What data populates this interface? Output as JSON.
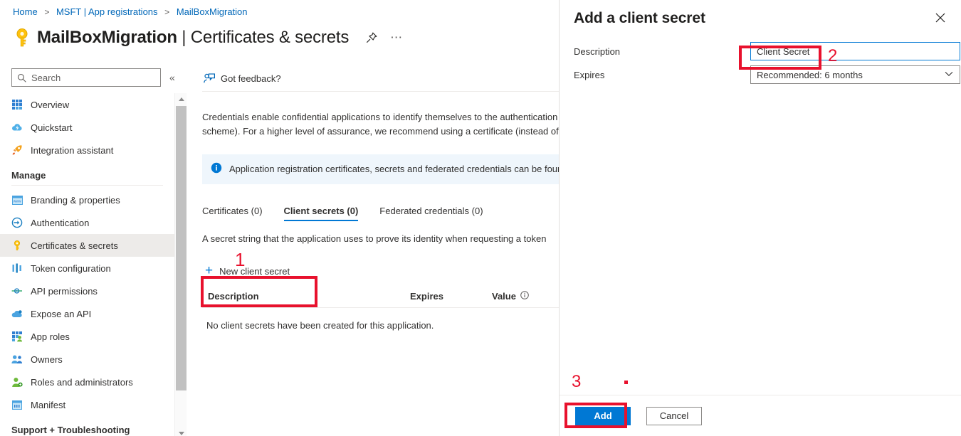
{
  "breadcrumb": {
    "items": [
      "Home",
      "MSFT | App registrations",
      "MailBoxMigration"
    ],
    "separator": ">"
  },
  "header": {
    "icon": "key-icon",
    "app_name": "MailBoxMigration",
    "divider": "|",
    "section": "Certificates & secrets",
    "pin_icon": "pin-icon",
    "more_icon": "ellipsis-icon"
  },
  "sidebar": {
    "search_placeholder": "Search",
    "search_value": "",
    "search_icon": "search-icon",
    "collapse_icon": "chevron-double-left-icon",
    "items": [
      {
        "label": "Overview",
        "icon": "grid-icon",
        "selected": false
      },
      {
        "label": "Quickstart",
        "icon": "cloud-lightning-icon",
        "selected": false
      },
      {
        "label": "Integration assistant",
        "icon": "rocket-icon",
        "selected": false
      }
    ],
    "group_label": "Manage",
    "manage_items": [
      {
        "label": "Branding & properties",
        "icon": "branding-icon",
        "selected": false
      },
      {
        "label": "Authentication",
        "icon": "authentication-icon",
        "selected": false
      },
      {
        "label": "Certificates & secrets",
        "icon": "key-icon",
        "selected": true
      },
      {
        "label": "Token configuration",
        "icon": "token-icon",
        "selected": false
      },
      {
        "label": "API permissions",
        "icon": "api-permissions-icon",
        "selected": false
      },
      {
        "label": "Expose an API",
        "icon": "expose-api-icon",
        "selected": false
      },
      {
        "label": "App roles",
        "icon": "app-roles-icon",
        "selected": false
      },
      {
        "label": "Owners",
        "icon": "owners-icon",
        "selected": false
      },
      {
        "label": "Roles and administrators",
        "icon": "roles-admin-icon",
        "selected": false
      },
      {
        "label": "Manifest",
        "icon": "manifest-icon",
        "selected": false
      }
    ],
    "bottom_group_label": "Support + Troubleshooting"
  },
  "command_bar": {
    "feedback_label": "Got feedback?",
    "feedback_icon": "feedback-person-icon"
  },
  "main": {
    "description": "Credentials enable confidential applications to identify themselves to the authentication scheme). For a higher level of assurance, we recommend using a certificate (instead of",
    "info_banner": {
      "icon": "info-icon",
      "text": "Application registration certificates, secrets and federated credentials can be found in"
    },
    "tabs": [
      {
        "label": "Certificates (0)",
        "active": false
      },
      {
        "label": "Client secrets (0)",
        "active": true
      },
      {
        "label": "Federated credentials (0)",
        "active": false
      }
    ],
    "secret_note": "A secret string that the application uses to prove its identity when requesting a token",
    "new_secret_button": "New client secret",
    "new_secret_icon": "plus-icon",
    "table": {
      "columns": [
        "Description",
        "Expires",
        "Value"
      ],
      "value_info_icon": "info-circle-icon",
      "rows": [],
      "empty_message": "No client secrets have been created for this application."
    }
  },
  "panel": {
    "title": "Add a client secret",
    "close_icon": "close-icon",
    "fields": [
      {
        "label": "Description",
        "value": "Client Secret",
        "type": "text"
      },
      {
        "label": "Expires",
        "value": "Recommended: 6 months",
        "type": "select",
        "chevron": "chevron-down-icon"
      }
    ],
    "primary_button": "Add",
    "secondary_button": "Cancel"
  },
  "annotations": {
    "step1": "1",
    "step2": "2",
    "step3": "3",
    "color": "#e8112d"
  }
}
